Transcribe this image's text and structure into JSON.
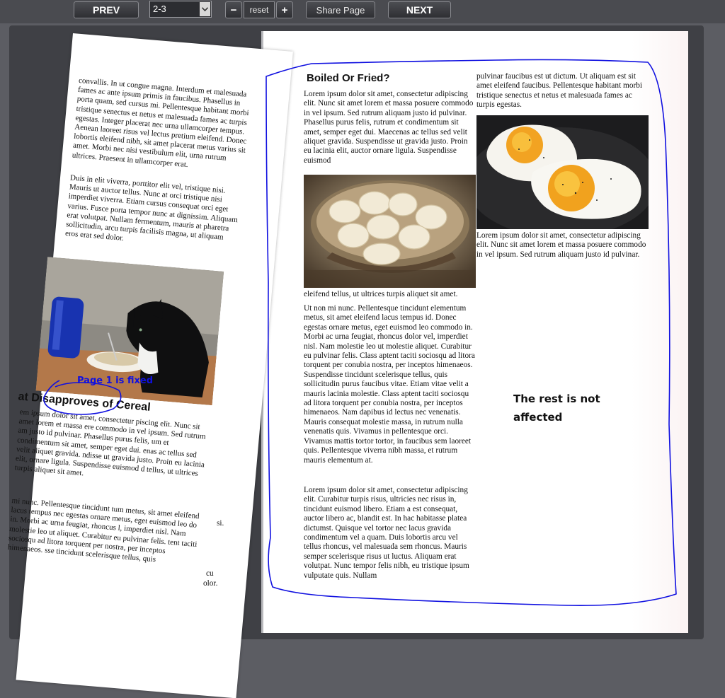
{
  "toolbar": {
    "prev_label": "PREV",
    "page_select_value": "2-3",
    "zoom_out_label": "−",
    "zoom_reset_label": "reset",
    "zoom_in_label": "+",
    "share_label": "Share Page",
    "next_label": "NEXT"
  },
  "left_page": {
    "top_text": "convallis. In ut congue magna. Interdum et malesuada fames ac ante ipsum primis in faucibus. Phasellus in porta quam, sed cursus mi. Pellentesque habitant morbi tristique senectus et netus et malesuada fames ac turpis egestas. Integer placerat nec urna ullamcorper tempus. Aenean laoreet risus vel lectus pretium eleifend. Donec lobortis eleifend nibh, sit amet placerat metus varius sit amet. Morbi nec nisi vestibulum elit, urna rutrum ultrices. Praesent in ullamcorper erat.",
    "top_text_2": "Duis in elit viverra, porttitor elit vel, tristique nisi. Mauris ut auctor tellus. Nunc at orci tristique nisi imperdiet viverra. Etiam cursus consequat orci eget varius. Fusce porta tempor nunc at dignissim. Aliquam erat volutpat. Nullam fermentum, mauris at pharetra sollicitudin, arcu turpis facilisis magna, ut aliquam eros erat sed dolor.",
    "heading": "at Disapproves of Cereal",
    "bottom_text": "em ipsum dolor sit amet, consectetur piscing elit. Nunc sit amet lorem et massa ere commodo in vel ipsum. Sed rutrum am justo id pulvinar. Phasellus purus felis, um et condimentum sit amet, semper eget dui. enas ac tellus sed velit aliquet gravida. ndisse ut gravida justo. Proin eu lacinia elit, ornare ligula. Suspendisse euismod d tellus, ut ultrices turpis aliquet sit amet.",
    "bottom_text_2": "mi nunc. Pellentesque tincidunt tum metus, sit amet eleifend lacus tempus nec egestas ornare metus, eget euismod leo do in. Morbi ac urna feugiat, rhoncus l, imperdiet nisl. Nam molestie leo ut aliquet. Curabitur eu pulvinar felis. tent taciti sociosqu ad litora torquent per nostra, per inceptos himenaeos. sse tincidunt scelerisque tellus, quis",
    "fragment_1": "si.",
    "fragment_2": "cu",
    "fragment_3": "olor."
  },
  "right_page": {
    "heading": "Boiled Or Fried?",
    "col1_p1": "Lorem ipsum dolor sit amet, consectetur adipiscing elit. Nunc sit amet lorem et massa posuere commodo in vel ipsum. Sed rutrum aliquam justo id pulvinar. Phasellus purus felis, rutrum et condimentum sit amet, semper eget dui. Maecenas ac tellus sed velit aliquet gravida. Suspendisse ut gravida justo. Proin eu lacinia elit, auctor ornare ligula. Suspendisse euismod",
    "col1_p2": "eleifend tellus, ut ultrices turpis aliquet sit amet.",
    "col1_p3": "Ut non mi nunc. Pellentesque tincidunt elementum metus, sit amet eleifend lacus tempus id. Donec egestas ornare metus, eget euismod leo commodo in. Morbi ac urna feugiat, rhoncus dolor vel, imperdiet nisl. Nam molestie leo ut molestie aliquet. Curabitur eu pulvinar felis. Class aptent taciti sociosqu ad litora torquent per conubia nostra, per inceptos himenaeos. Suspendisse tincidunt scelerisque tellus, quis sollicitudin purus faucibus vitae. Etiam vitae velit a mauris lacinia molestie. Class aptent taciti sociosqu ad litora torquent per conubia nostra, per inceptos himenaeos. Nam dapibus id lectus nec venenatis. Mauris consequat molestie massa, in rutrum nulla venenatis quis. Vivamus in pellentesque orci. Vivamus mattis tortor tortor, in faucibus sem laoreet quis. Pellentesque viverra nibh massa, et rutrum mauris elementum at.",
    "col1_p4": "Lorem ipsum dolor sit amet, consectetur adipiscing elit. Curabitur turpis risus, ultricies nec risus in, tincidunt euismod libero. Etiam a est consequat, auctor libero ac, blandit est. In hac habitasse platea dictumst. Quisque vel tortor nec lacus gravida condimentum vel a quam. Duis lobortis arcu vel tellus rhoncus, vel malesuada sem rhoncus. Mauris semper scelerisque risus ut luctus. Aliquam erat volutpat. Nunc tempor felis nibh, eu tristique ipsum vulputate quis. Nullam",
    "col2_p1": "pulvinar faucibus est ut dictum. Ut aliquam est sit amet eleifend faucibus. Pellentesque habitant morbi tristique senectus et netus et malesuada fames ac turpis egestas.",
    "col2_p2": "Lorem ipsum dolor sit amet, consectetur adipiscing elit. Nunc sit amet lorem et massa posuere commodo in vel ipsum. Sed rutrum aliquam justo id pulvinar."
  },
  "annotations": {
    "left_note": "Page 1 is fixed",
    "right_note": "The rest is not affected",
    "ink_color": "#1010e0"
  },
  "icons": {
    "select_arrow": "chevron-down-icon"
  }
}
